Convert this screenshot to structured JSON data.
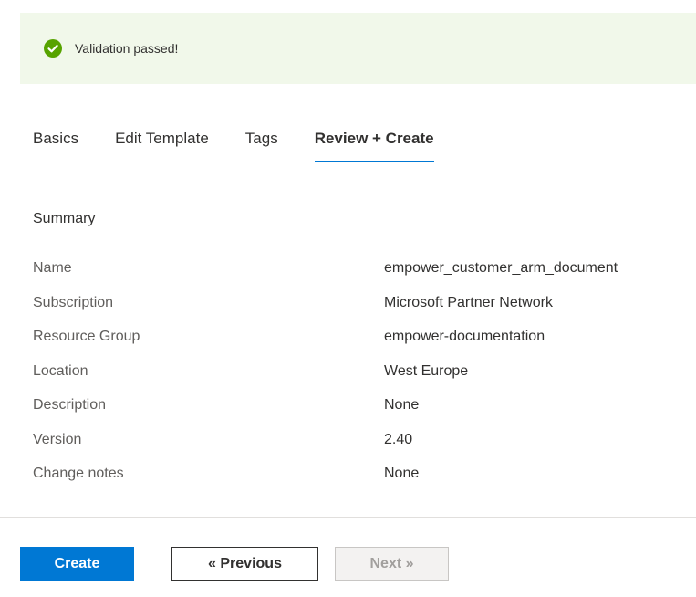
{
  "banner": {
    "text": "Validation passed!",
    "icon": "check-circle-icon",
    "color": "#57a300",
    "background": "#f1f8ea"
  },
  "tabs": [
    {
      "label": "Basics",
      "active": false
    },
    {
      "label": "Edit Template",
      "active": false
    },
    {
      "label": "Tags",
      "active": false
    },
    {
      "label": "Review + Create",
      "active": true
    }
  ],
  "summary": {
    "title": "Summary",
    "rows": [
      {
        "label": "Name",
        "value": "empower_customer_arm_document"
      },
      {
        "label": "Subscription",
        "value": "Microsoft Partner Network"
      },
      {
        "label": "Resource Group",
        "value": "empower-documentation"
      },
      {
        "label": "Location",
        "value": "West Europe"
      },
      {
        "label": "Description",
        "value": "None"
      },
      {
        "label": "Version",
        "value": "2.40"
      },
      {
        "label": "Change notes",
        "value": "None"
      }
    ]
  },
  "footer": {
    "create_label": "Create",
    "previous_label": "« Previous",
    "next_label": "Next »",
    "next_disabled": true
  },
  "colors": {
    "accent": "#0078d4",
    "success": "#57a300"
  }
}
